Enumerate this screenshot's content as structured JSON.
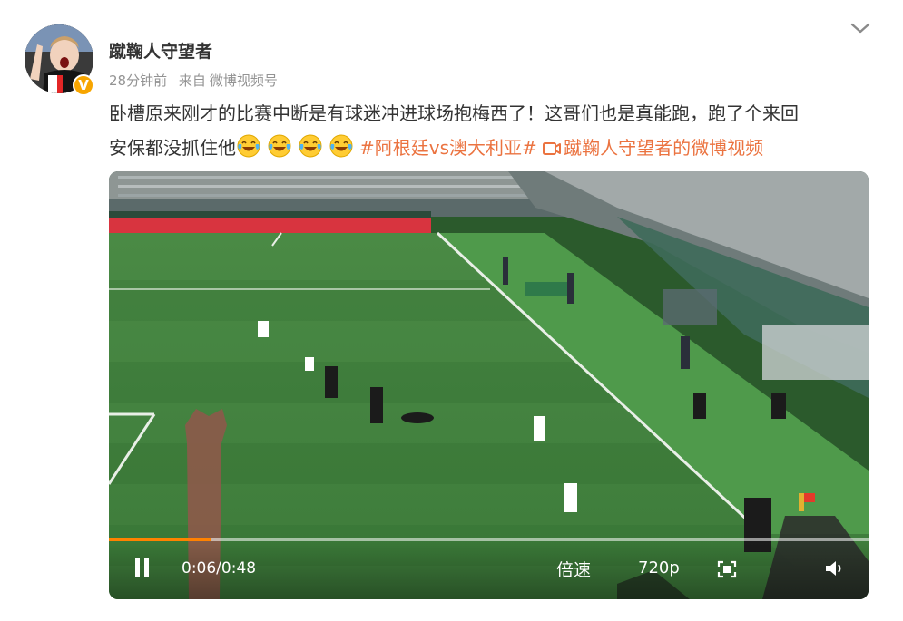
{
  "post": {
    "username": "蹴鞠人守望者",
    "time_ago": "28分钟前",
    "source_prefix": "来自",
    "source": "微博视频号",
    "verified_badge": "V",
    "text_line1": "卧槽原来刚才的比赛中断是有球迷冲进球场抱梅西了！这哥们也是真能跑，跑了个来回",
    "text_line2": "安保都没抓住他",
    "emoji_count": 4,
    "hashtag": "#阿根廷vs澳大利亚#",
    "video_link": "蹴鞠人守望者的微博视频"
  },
  "player": {
    "current_time": "0:06",
    "duration": "0:48",
    "time_display": "0:06/0:48",
    "progress": 0.135,
    "speed_label": "倍速",
    "quality_label": "720p"
  },
  "colors": {
    "accent": "#eb7340",
    "progress": "#ff8200",
    "badge": "#f7a500",
    "meta": "#939393"
  },
  "icons": {
    "more": "chevron-down-icon",
    "emoji": "laughing-tears-emoji",
    "video_link": "video-camera-icon",
    "fullscreen": "fullscreen-icon",
    "volume": "volume-icon",
    "pause": "pause-icon"
  }
}
